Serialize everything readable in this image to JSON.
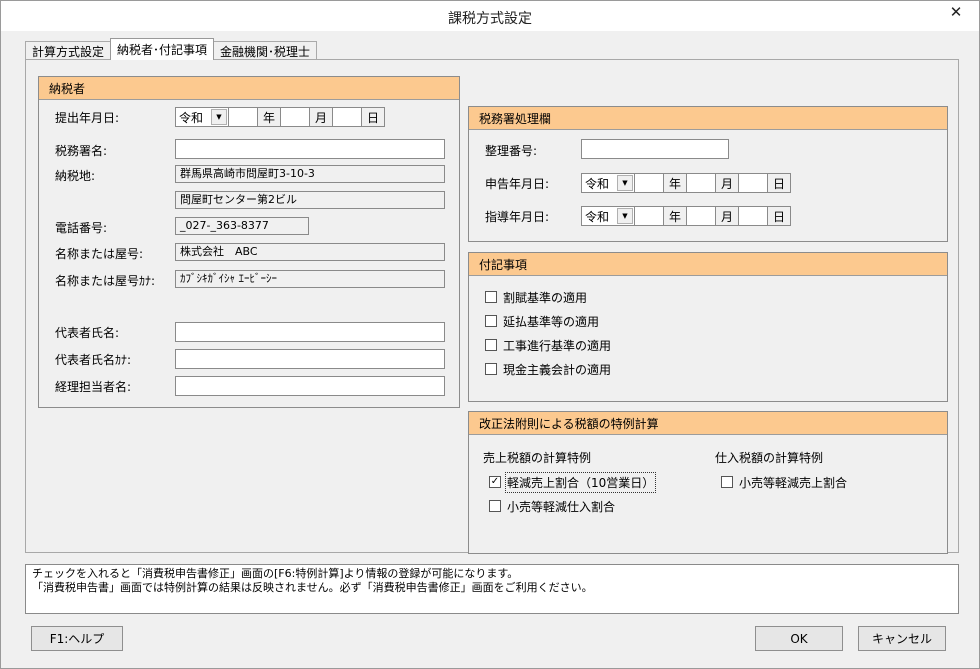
{
  "window": {
    "title": "課税方式設定"
  },
  "tabs": [
    {
      "label": "計算方式設定"
    },
    {
      "label": "納税者･付記事項"
    },
    {
      "label": "金融機関･税理士"
    }
  ],
  "taxpayer": {
    "header": "納税者",
    "submit_date_label": "提出年月日:",
    "submit_date": {
      "era": "令和",
      "year_unit": "年",
      "month_unit": "月",
      "day_unit": "日"
    },
    "office_label": "税務署名:",
    "address_label": "納税地:",
    "address_line1": "群馬県高崎市問屋町3-10-3",
    "address_line2": "問屋町センター第2ビル",
    "phone_label": "電話番号:",
    "phone": "_027-_363-8377",
    "name_label": "名称または屋号:",
    "name": "株式会社　ABC",
    "name_kana_label": "名称または屋号ｶﾅ:",
    "name_kana": "ｶﾌﾞｼｷｶﾞｲｼｬ ｴｰﾋﾞｰｼｰ",
    "rep_label": "代表者氏名:",
    "rep_kana_label": "代表者氏名ｶﾅ:",
    "accountant_label": "経理担当者名:"
  },
  "office": {
    "header": "税務署処理欄",
    "ref_label": "整理番号:",
    "report_date_label": "申告年月日:",
    "guide_date_label": "指導年月日:",
    "era": "令和",
    "year_unit": "年",
    "month_unit": "月",
    "day_unit": "日"
  },
  "notes": {
    "header": "付記事項",
    "items": [
      {
        "label": "割賦基準の適用",
        "checked": false
      },
      {
        "label": "延払基準等の適用",
        "checked": false
      },
      {
        "label": "工事進行基準の適用",
        "checked": false
      },
      {
        "label": "現金主義会計の適用",
        "checked": false
      }
    ]
  },
  "special": {
    "header": "改正法附則による税額の特例計算",
    "sales_title": "売上税額の計算特例",
    "purchase_title": "仕入税額の計算特例",
    "sales_items": [
      {
        "label": "軽減売上割合（10営業日）",
        "checked": true
      },
      {
        "label": "小売等軽減仕入割合",
        "checked": false
      }
    ],
    "purchase_items": [
      {
        "label": "小売等軽減売上割合",
        "checked": false
      }
    ]
  },
  "message": {
    "line1": "チェックを入れると「消費税申告書修正」画面の[F6:特例計算]より情報の登録が可能になります。",
    "line2": "「消費税申告書」画面では特例計算の結果は反映されません。必ず「消費税申告書修正」画面をご利用ください。"
  },
  "buttons": {
    "help": "F1:ヘルプ",
    "ok": "OK",
    "cancel": "キャンセル"
  },
  "icons": {
    "close": "close-icon",
    "dropdown": "chevron-down-icon",
    "checkbox": "checkbox-icon"
  }
}
